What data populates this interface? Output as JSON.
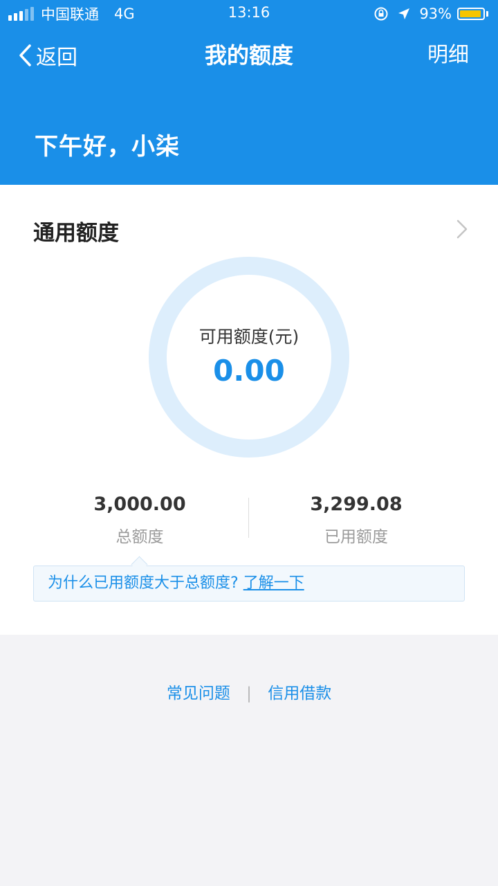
{
  "status_bar": {
    "carrier": "中国联通",
    "network": "4G",
    "time": "13:16",
    "battery": "93%",
    "battery_level": 0.93,
    "battery_color": "#f7c500"
  },
  "nav": {
    "back_label": "返回",
    "title": "我的额度",
    "right_label": "明细"
  },
  "greeting": "下午好，小柒",
  "quota": {
    "section_title": "通用额度",
    "available_label": "可用额度(元)",
    "available_value": "0.00",
    "total_value": "3,000.00",
    "total_label": "总额度",
    "used_value": "3,299.08",
    "used_label": "已用额度"
  },
  "notice": {
    "text": "为什么已用额度大于总额度?",
    "link": "了解一下"
  },
  "footer": {
    "link1": "常见问题",
    "separator": "|",
    "link2": "信用借款"
  },
  "colors": {
    "primary": "#1a8fe8",
    "ring": "#ddeefc",
    "background": "#f3f3f6"
  }
}
